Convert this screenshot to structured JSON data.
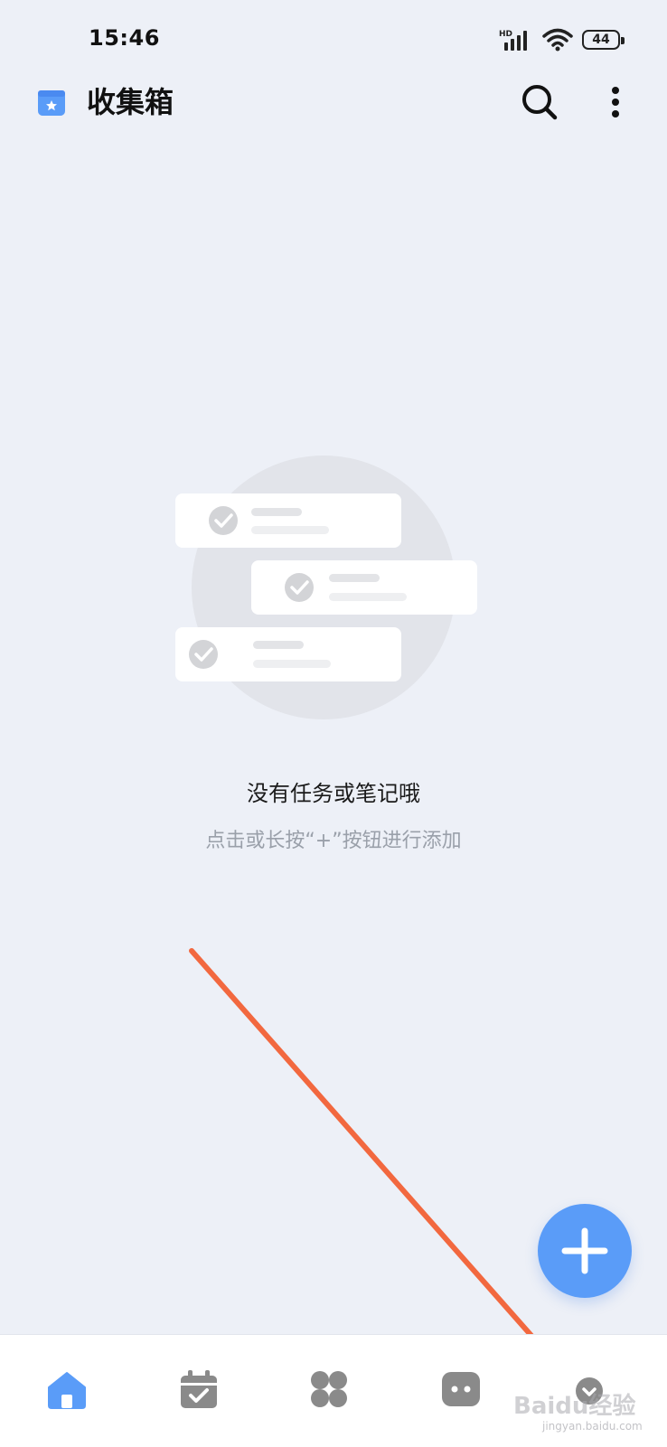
{
  "status_bar": {
    "time": "15:46",
    "network": "HD",
    "battery": "44"
  },
  "header": {
    "title": "收集箱",
    "icon": "inbox-star-icon"
  },
  "empty_state": {
    "title": "没有任务或笔记哦",
    "hint": "点击或长按“+”按钮进行添加"
  },
  "fab": {
    "icon": "plus-icon"
  },
  "bottom_nav": {
    "items": [
      {
        "icon": "home-icon",
        "active": true
      },
      {
        "icon": "calendar-check-icon",
        "active": false
      },
      {
        "icon": "four-leaf-grid-icon",
        "active": false
      },
      {
        "icon": "robot-face-icon",
        "active": false
      },
      {
        "icon": "chevron-circle-icon",
        "active": false
      }
    ]
  },
  "watermark": {
    "text": "Baidu经验",
    "sub": "jingyan.baidu.com"
  },
  "colors": {
    "accent": "#5a9cf8",
    "background": "#edf0f7",
    "arrow": "#f2683f",
    "inactive_icon": "#8a8a8a"
  }
}
